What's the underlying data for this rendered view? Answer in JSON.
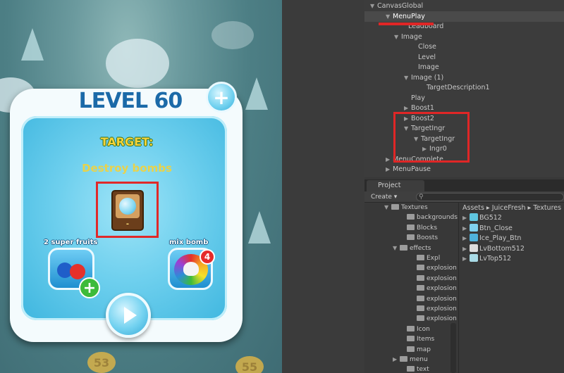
{
  "game": {
    "level_title": "LEVEL 60",
    "plus_symbol": "+",
    "target_label": "TARGET:",
    "target_description": "Destroy bombs",
    "target_count": "-",
    "boost1_label": "2 super fruits",
    "boost1_add_symbol": "+",
    "boost2_label": "mix bomb",
    "boost2_count": "4",
    "bg_level_left": "53",
    "bg_level_right": "55"
  },
  "hierarchy": {
    "items": [
      {
        "label": "CanvasGlobal",
        "arrow": "▼"
      },
      {
        "label": "MenuPlay",
        "arrow": "▼"
      },
      {
        "label": "Leadboard",
        "arrow": ""
      },
      {
        "label": "Image",
        "arrow": "▼"
      },
      {
        "label": "Close",
        "arrow": ""
      },
      {
        "label": "Level",
        "arrow": ""
      },
      {
        "label": "Image",
        "arrow": ""
      },
      {
        "label": "Image (1)",
        "arrow": "▼"
      },
      {
        "label": "TargetDescription1",
        "arrow": ""
      },
      {
        "label": "Play",
        "arrow": ""
      },
      {
        "label": "Boost1",
        "arrow": "▶"
      },
      {
        "label": "Boost2",
        "arrow": "▶"
      },
      {
        "label": "TargetIngr",
        "arrow": "▼"
      },
      {
        "label": "TargetIngr",
        "arrow": "▼"
      },
      {
        "label": "Ingr0",
        "arrow": "▶"
      },
      {
        "label": "MenuComplete",
        "arrow": "▶"
      },
      {
        "label": "MenuPause",
        "arrow": "▶"
      }
    ]
  },
  "project": {
    "tab_label": "Project",
    "create_label": "Create ▾",
    "search_icon": "⚲",
    "tree": [
      {
        "label": "Textures",
        "arrow": "▼"
      },
      {
        "label": "backgrounds",
        "arrow": ""
      },
      {
        "label": "Blocks",
        "arrow": ""
      },
      {
        "label": "Boosts",
        "arrow": ""
      },
      {
        "label": "effects",
        "arrow": "▼"
      },
      {
        "label": "Expl",
        "arrow": ""
      },
      {
        "label": "explosion",
        "arrow": ""
      },
      {
        "label": "explosion",
        "arrow": ""
      },
      {
        "label": "explosion",
        "arrow": ""
      },
      {
        "label": "explosion",
        "arrow": ""
      },
      {
        "label": "explosion",
        "arrow": ""
      },
      {
        "label": "explosion",
        "arrow": ""
      },
      {
        "label": "Icon",
        "arrow": ""
      },
      {
        "label": "Items",
        "arrow": ""
      },
      {
        "label": "map",
        "arrow": ""
      },
      {
        "label": "menu",
        "arrow": "▶"
      },
      {
        "label": "text",
        "arrow": ""
      }
    ],
    "breadcrumb": "Assets ▸ JuiceFresh ▸ Textures",
    "assets": [
      {
        "label": "BG512",
        "color": "#5fc6e0"
      },
      {
        "label": "Btn_Close",
        "color": "#7fd0ee"
      },
      {
        "label": "Ice_Play_Btn",
        "color": "#4fb2dc"
      },
      {
        "label": "LvBottom512",
        "color": "#dddddd"
      },
      {
        "label": "LvTop512",
        "color": "#a9dbe6"
      }
    ]
  },
  "colors": {
    "highlight": "#e02626",
    "accent": "#1b6aa8"
  }
}
